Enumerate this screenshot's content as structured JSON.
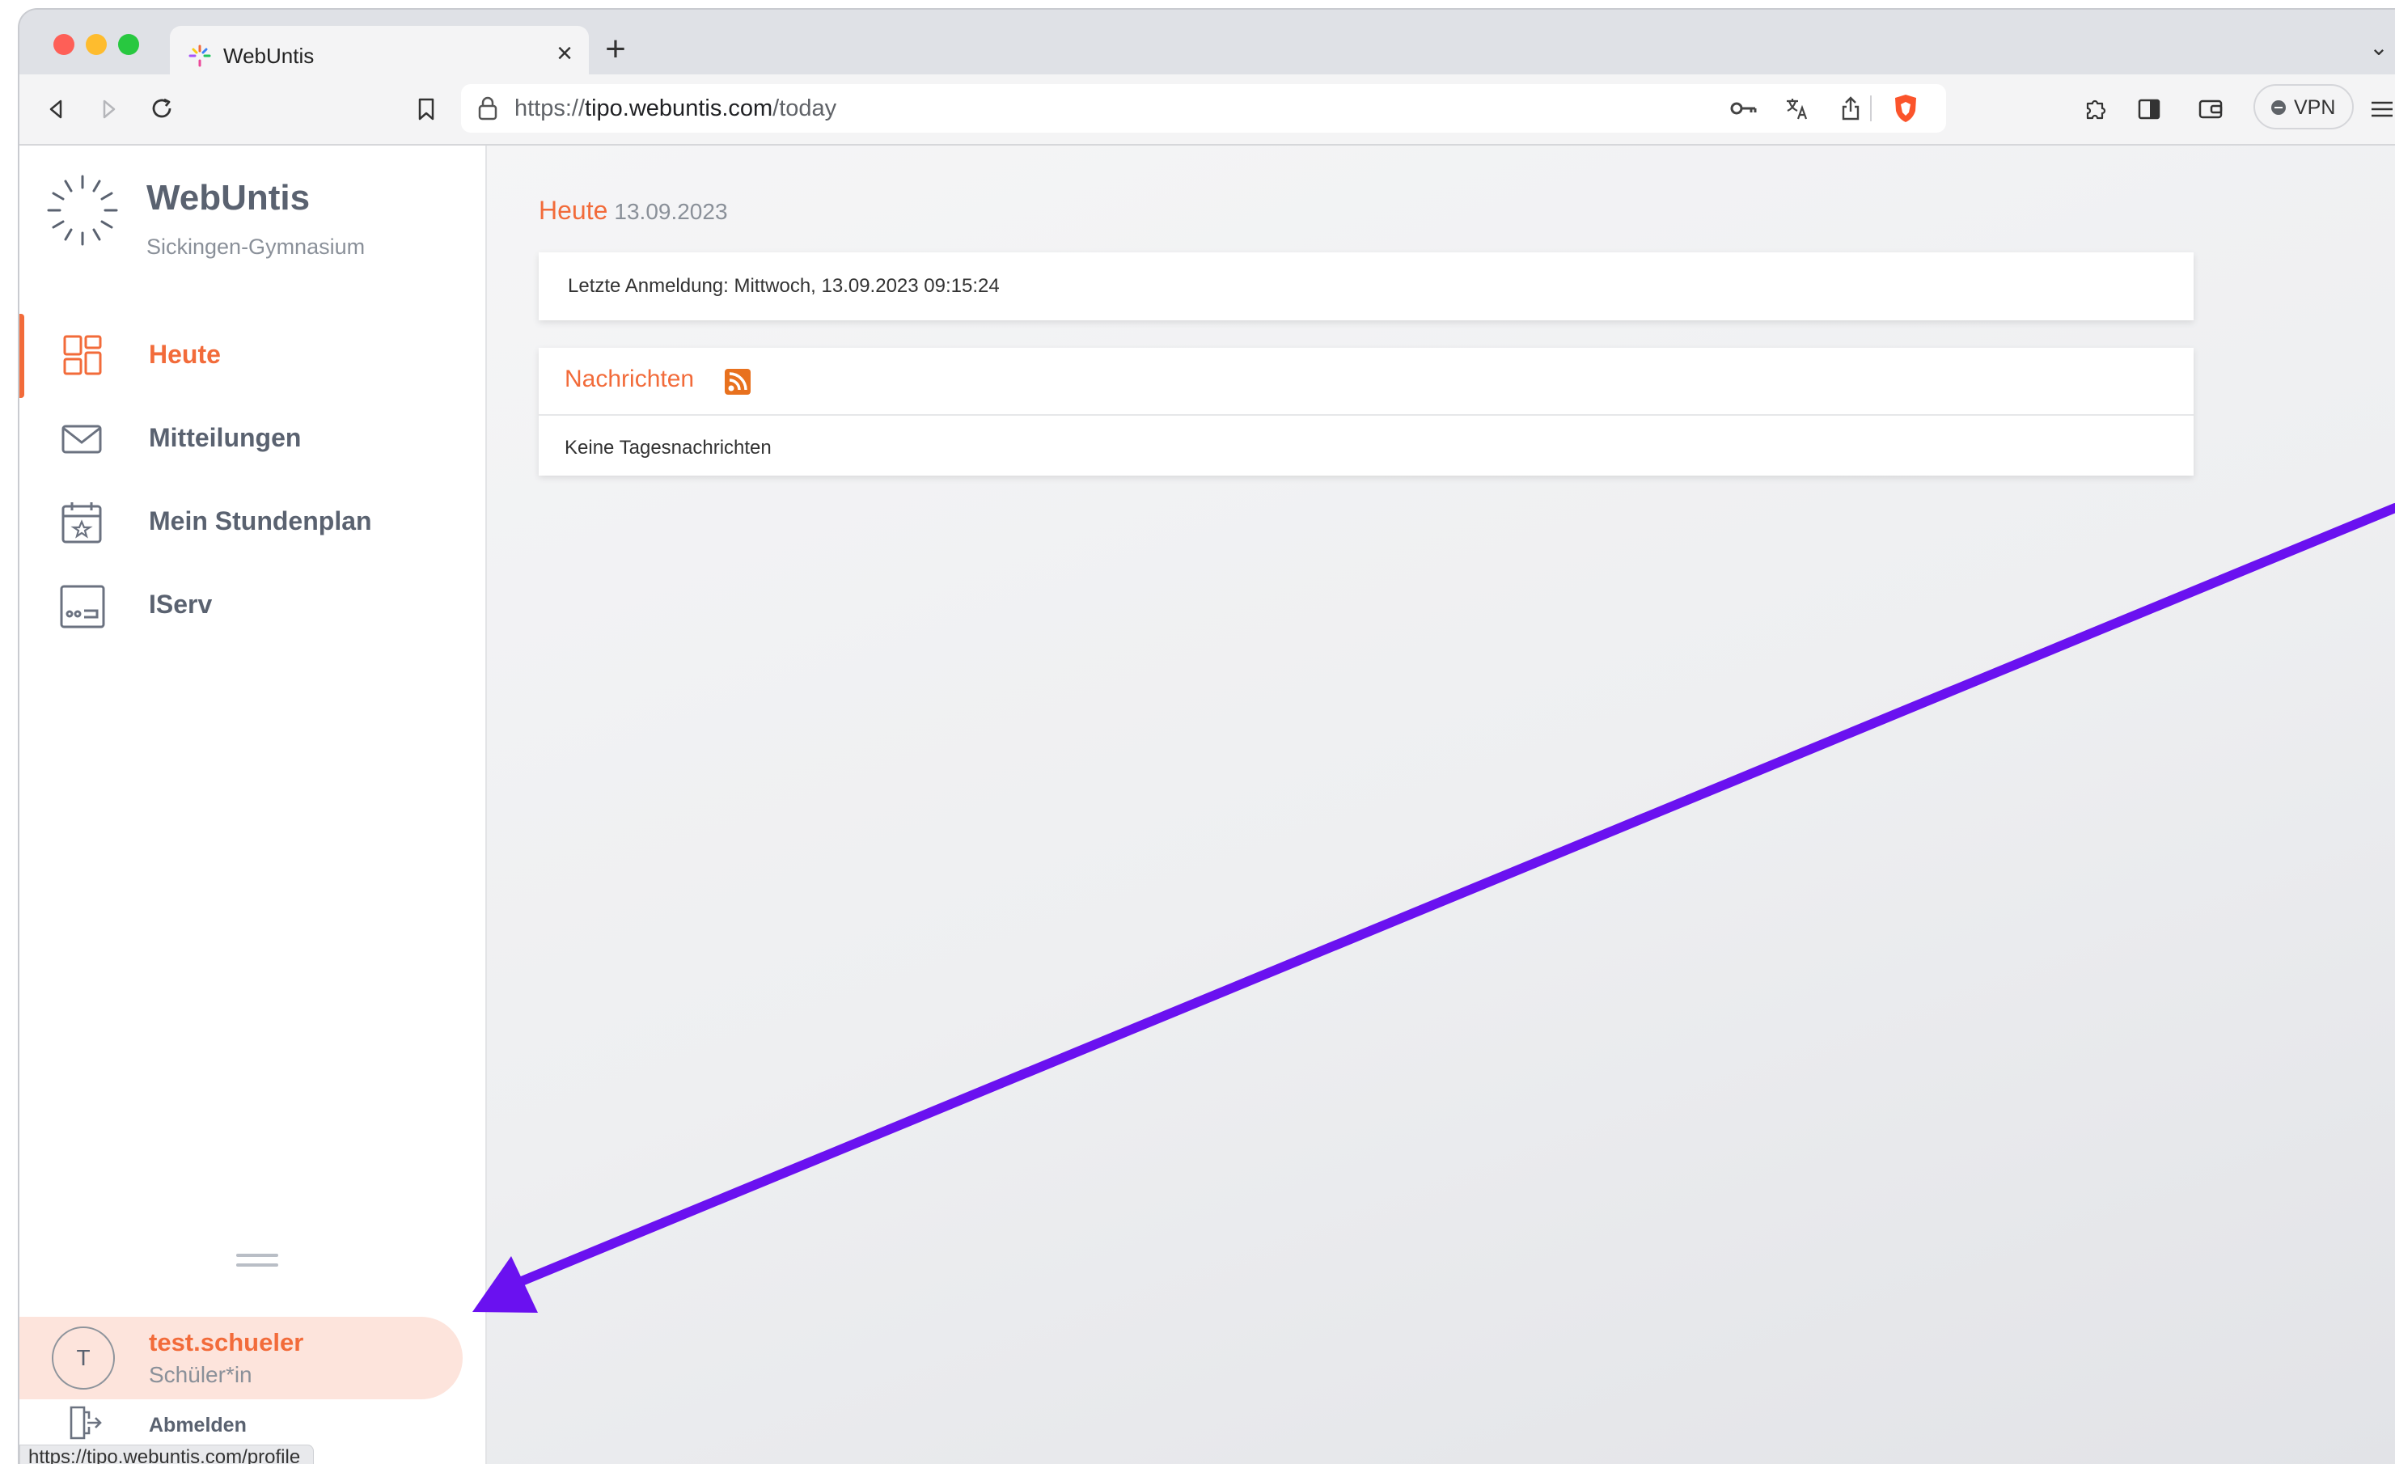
{
  "browser": {
    "tab_title": "WebUntis",
    "url_prefix": "https://",
    "url_host": "tipo.webuntis.com",
    "url_path": "/today",
    "vpn_label": "VPN",
    "status_url": "https://tipo.webuntis.com/profile"
  },
  "sidebar": {
    "app_name": "WebUntis",
    "school": "Sickingen-Gymnasium",
    "items": [
      {
        "label": "Heute",
        "icon": "dashboard-icon",
        "active": true
      },
      {
        "label": "Mitteilungen",
        "icon": "mail-icon",
        "active": false
      },
      {
        "label": "Mein Stundenplan",
        "icon": "calendar-star-icon",
        "active": false
      },
      {
        "label": "IServ",
        "icon": "iserv-icon",
        "active": false
      }
    ],
    "profile": {
      "initial": "T",
      "name": "test.schueler",
      "role": "Schüler*in"
    },
    "logout_label": "Abmelden"
  },
  "main": {
    "title": "Heute",
    "date": "13.09.2023",
    "last_login": "Letzte Anmeldung: Mittwoch, 13.09.2023 09:15:24",
    "news_title": "Nachrichten",
    "news_empty": "Keine Tagesnachrichten"
  },
  "colors": {
    "accent": "#f26b3a",
    "annotation_arrow": "#6a11f0"
  }
}
